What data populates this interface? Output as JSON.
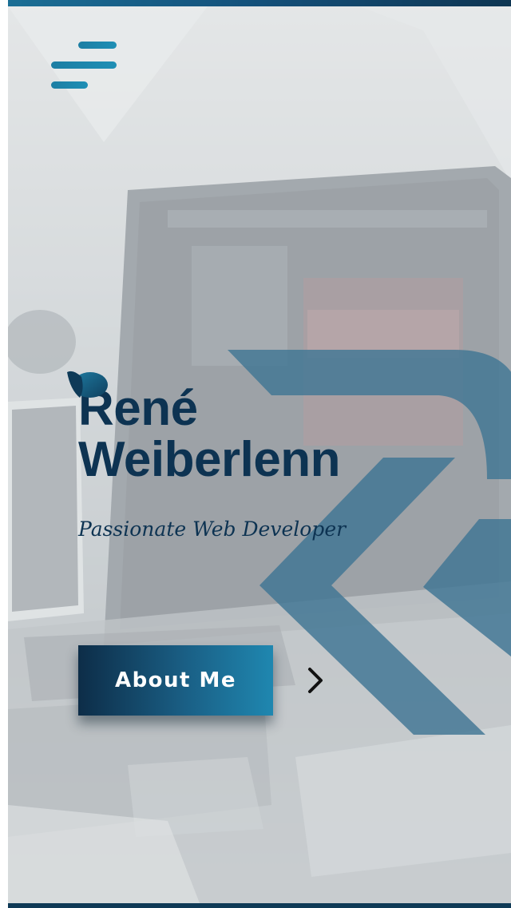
{
  "header": {
    "menu_icon": "hamburger-menu-icon"
  },
  "hero": {
    "name_line1": "René",
    "name_line2": "Weiberlenn",
    "subtitle": "Passionate Web Developer",
    "hat_icon": "hat-icon"
  },
  "cta": {
    "about_label": "About Me",
    "next_icon": "chevron-right-icon"
  },
  "colors": {
    "accent": "#1f87b0",
    "navy": "#0d3352",
    "deco": "#4f7f9b",
    "background": "#e9ebec"
  }
}
